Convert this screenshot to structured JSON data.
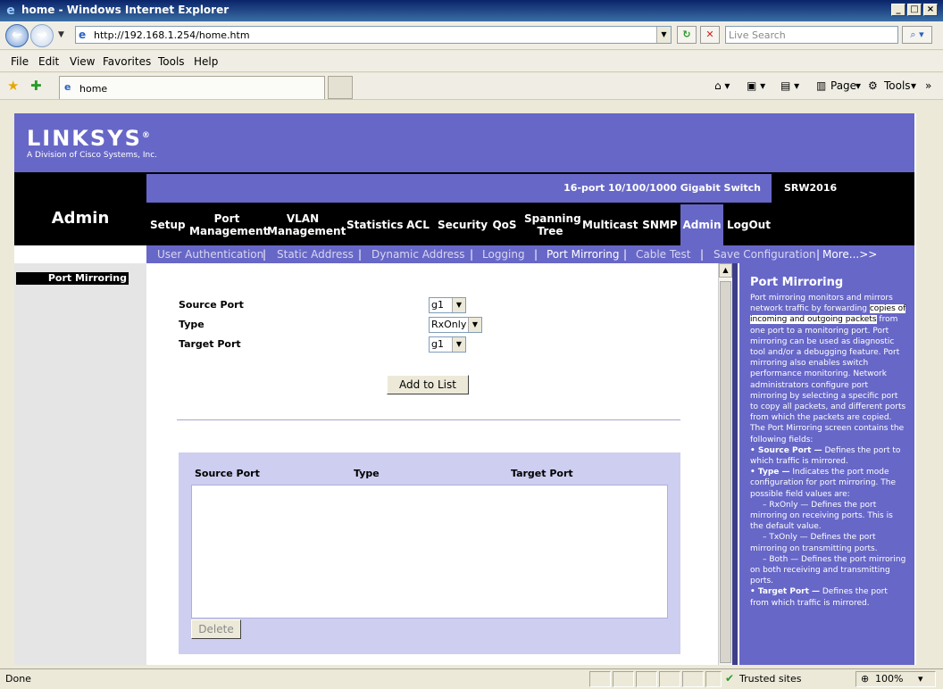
{
  "window": {
    "title": "home - Windows Internet Explorer"
  },
  "address": {
    "url": "http://192.168.1.254/home.htm",
    "search_placeholder": "Live Search"
  },
  "menu": [
    "File",
    "Edit",
    "View",
    "Favorites",
    "Tools",
    "Help"
  ],
  "tab": {
    "label": "home"
  },
  "toolbar": {
    "page": "Page",
    "tools": "Tools"
  },
  "brand": {
    "logo": "LINKSYS",
    "tagline": "A Division of Cisco Systems, Inc."
  },
  "header": {
    "section": "Admin",
    "product": "16-port 10/100/1000 Gigabit Switch",
    "model": "SRW2016"
  },
  "nav": [
    {
      "label": "Setup"
    },
    {
      "label": "Port Management"
    },
    {
      "label": "VLAN Management"
    },
    {
      "label": "Statistics"
    },
    {
      "label": "ACL"
    },
    {
      "label": "Security"
    },
    {
      "label": "QoS"
    },
    {
      "label": "Spanning Tree"
    },
    {
      "label": "Multicast"
    },
    {
      "label": "SNMP"
    },
    {
      "label": "Admin"
    },
    {
      "label": "LogOut"
    }
  ],
  "subnav": [
    "User Authentication",
    "Static Address",
    "Dynamic Address",
    "Logging",
    "Port Mirroring",
    "Cable Test",
    "Save Configuration",
    "More...>>"
  ],
  "subnav_separator": "|",
  "sidebar": {
    "current": "Port Mirroring"
  },
  "form": {
    "source_port_label": "Source Port",
    "source_port_value": "g1",
    "type_label": "Type",
    "type_value": "RxOnly",
    "target_port_label": "Target Port",
    "target_port_value": "g1",
    "add_button": "Add to List"
  },
  "table": {
    "columns": [
      "Source Port",
      "Type",
      "Target Port"
    ],
    "rows": [],
    "delete_button": "Delete"
  },
  "help": {
    "title": "Port Mirroring",
    "intro_a": "Port mirroring monitors and mirrors network traffic by forwarding ",
    "intro_highlight": "copies of incoming and outgoing packets",
    "intro_b": " from one port to a monitoring port. Port mirroring can be used as diagnostic tool and/or a debugging feature. Port mirroring also enables switch performance monitoring. Network administrators configure port mirroring by selecting a specific port to copy all packets, and different ports from which the packets are copied.",
    "fields_intro": "The Port Mirroring screen contains the following fields:",
    "bullet1_term": "• Source Port —",
    "bullet1_text": " Defines the port to which traffic is mirrored.",
    "bullet2_term": "• Type —",
    "bullet2_text": " Indicates the port mode configuration for port mirroring. The possible field values are:",
    "opt1": "– RxOnly — Defines the port mirroring on receiving ports. This is the default value.",
    "opt2": "– TxOnly — Defines the port mirroring on transmitting ports.",
    "opt3": "– Both — Defines the port mirroring on both receiving and transmitting ports.",
    "bullet3_term": "• Target Port —",
    "bullet3_text": " Defines the port from which traffic is mirrored."
  },
  "status": {
    "text": "Done",
    "zone": "Trusted sites",
    "zoom": "100%"
  }
}
